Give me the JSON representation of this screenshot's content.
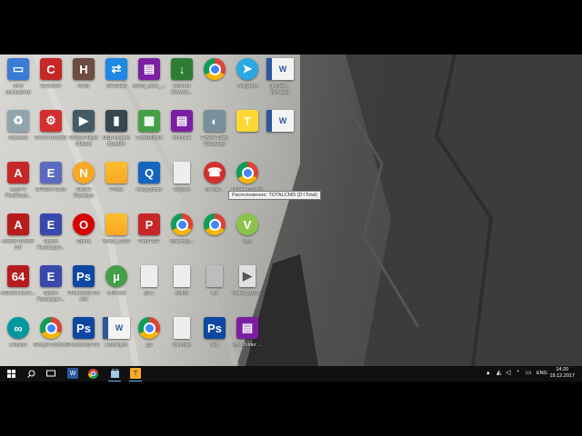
{
  "desktop": {
    "icons": [
      {
        "label": "Этот компьютер",
        "icon": "computer-icon",
        "color": "#3a7bd5"
      },
      {
        "label": "CCleaner",
        "icon": "ccleaner-icon",
        "color": "#c62828"
      },
      {
        "label": "Havij",
        "icon": "havij-icon",
        "color": "#6d4c41"
      },
      {
        "label": "SHAREit",
        "icon": "shareit-icon",
        "color": "#1e88e5"
      },
      {
        "label": "BIOS_Acer_...",
        "icon": "winrar-icon",
        "color": "#7b1fa2"
      },
      {
        "label": "Internet Downlo...",
        "icon": "idm-icon",
        "color": "#2e7d32"
      },
      {
        "label": "",
        "icon": "chrome-icon",
        "color": "#e53935"
      },
      {
        "label": "Telegram",
        "icon": "telegram-icon",
        "color": "#29a9e1"
      },
      {
        "label": "gitCast... путевая",
        "icon": "word-doc-icon",
        "color": "#2b579a"
      },
      {
        "label": "Корзина",
        "icon": "recycle-bin-icon",
        "color": "#90a4ae"
      },
      {
        "label": "Driver Booster",
        "icon": "driver-booster-icon",
        "color": "#d32f2f"
      },
      {
        "label": "Media Player Classic",
        "icon": "mpc-icon",
        "color": "#455a64"
      },
      {
        "label": "USB-модем Билайн",
        "icon": "usb-modem-icon",
        "color": "#37474f"
      },
      {
        "label": "CodeBlocks",
        "icon": "codeblocks-icon",
        "color": "#43a047"
      },
      {
        "label": "ishchilar",
        "icon": "winrar-icon",
        "color": "#7b1fa2"
      },
      {
        "label": "Power Data Recovery",
        "icon": "recovery-icon",
        "color": "#78909c"
      },
      {
        "label": "",
        "icon": "totalcmd-icon",
        "color": "#fdd835"
      },
      {
        "label": "",
        "icon": "word-doc-icon",
        "color": "#2b579a"
      },
      {
        "label": "ABBYY FineRead...",
        "icon": "abbyy-icon",
        "color": "#c62828"
      },
      {
        "label": "EPSON Scan",
        "icon": "epson-scan-icon",
        "color": "#5c6bc0"
      },
      {
        "label": "Nicolai Premium",
        "icon": "nicolai-icon",
        "color": "#f9a825"
      },
      {
        "label": "Photo",
        "icon": "folder-icon",
        "color": "#fbc02d"
      },
      {
        "label": "easyQuizzy",
        "icon": "easyquizzy-icon",
        "color": "#1565c0"
      },
      {
        "label": "Keyinfo",
        "icon": "file-icon",
        "color": "#eeeeee"
      },
      {
        "label": "on call...",
        "icon": "on-call-icon",
        "color": "#d32f2f"
      },
      {
        "label": "Uzbek (2).doc",
        "icon": "chrome-icon",
        "color": "#e53935"
      },
      {
        "label": "Adobe Reader 6.0",
        "icon": "adobe-reader-icon",
        "color": "#b71c1c"
      },
      {
        "label": "Epson Руководст...",
        "icon": "epson-manual-icon",
        "color": "#3949ab"
      },
      {
        "label": "Opera",
        "icon": "opera-icon",
        "color": "#d50000"
      },
      {
        "label": "Kneyt_CMS",
        "icon": "folder-icon",
        "color": "#fbc02d"
      },
      {
        "label": "First PDF",
        "icon": "first-pdf-icon",
        "color": "#c62828"
      },
      {
        "label": "Khamtoy...",
        "icon": "chrome-icon",
        "color": "#e53935"
      },
      {
        "label": "",
        "icon": "chrome-icon",
        "color": "#e53935"
      },
      {
        "label": "vBB",
        "icon": "vbb-icon",
        "color": "#8bc34a"
      },
      {
        "label": "AIDA64 Extre...",
        "icon": "aida64-icon",
        "color": "#b71c1c"
      },
      {
        "label": "Epson Руководст...",
        "icon": "epson-manual-icon",
        "color": "#3949ab"
      },
      {
        "label": "Photoshop CC x64",
        "icon": "photoshop-icon",
        "color": "#0d47a1"
      },
      {
        "label": "uTorrent",
        "icon": "utorrent-icon",
        "color": "#43a047"
      },
      {
        "label": "g3.1",
        "icon": "file-icon",
        "color": "#eeeeee"
      },
      {
        "label": "kollos",
        "icon": "file-icon",
        "color": "#eeeeee"
      },
      {
        "label": "lxx",
        "icon": "file-icon",
        "color": "#bdbdbd"
      },
      {
        "label": "Video_2017...",
        "icon": "video-file-icon",
        "color": "#e0e0e0"
      },
      {
        "label": "Arduino",
        "icon": "arduino-icon",
        "color": "#00979d"
      },
      {
        "label": "Google Chrome",
        "icon": "chrome-icon",
        "color": "#e53935"
      },
      {
        "label": "Photoshop CC",
        "icon": "photoshop-icon",
        "color": "#0d47a1"
      },
      {
        "label": "Ahmadjon",
        "icon": "word-doc-icon",
        "color": "#2b579a"
      },
      {
        "label": "g3",
        "icon": "chrome-icon",
        "color": "#e53935"
      },
      {
        "label": "Idiomas",
        "icon": "file-icon",
        "color": "#eeeeee"
      },
      {
        "label": "ladi",
        "icon": "photoshop-file-icon",
        "color": "#0d47a1"
      },
      {
        "label": "cmd folder ...",
        "icon": "winrar-icon",
        "color": "#7b1fa2"
      }
    ]
  },
  "tooltip": {
    "text": "Расположение: TOTALCMD (D:\\Total)"
  },
  "taskbar": {
    "lang": "ENG",
    "time": "14:20",
    "date": "19.12.2017"
  }
}
